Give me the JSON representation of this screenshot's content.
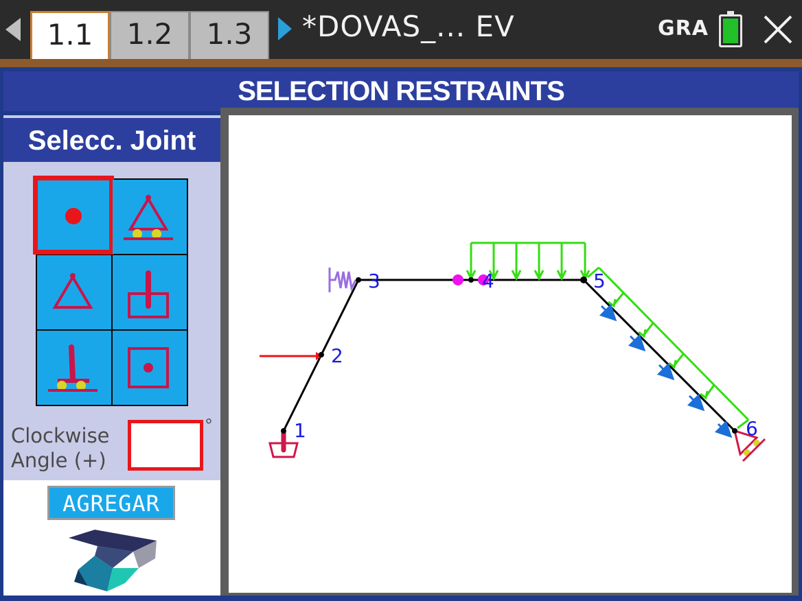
{
  "tabs": [
    {
      "label": "1.1",
      "active": true
    },
    {
      "label": "1.2",
      "active": false
    },
    {
      "label": "1.3",
      "active": false
    }
  ],
  "document": {
    "title": "*DOVAS_... EV"
  },
  "status": {
    "mode": "GRA",
    "battery_color": "#22c12a"
  },
  "header": {
    "title": "SELECTION RESTRAINTS"
  },
  "panel": {
    "title": "Selecc. Joint",
    "restraint_icons": [
      "free-joint-icon",
      "roller-pin-icon",
      "pin-support-icon",
      "fixed-support-icon",
      "roller-fixed-icon",
      "fixed-point-icon"
    ],
    "selected_index": 0,
    "angle_label_line1": "Clockwise",
    "angle_label_line2": "Angle (+)",
    "angle_value": "",
    "degree_symbol": "°",
    "add_button": "AGREGAR"
  },
  "structure": {
    "joint_labels": [
      "1",
      "2",
      "3",
      "4",
      "5",
      "6"
    ],
    "colors": {
      "member": "#000000",
      "restraint": "#d0164a",
      "distributed_load": "#33dd11",
      "axial_load": "#1a6fd8",
      "point_load": "#e8161b",
      "spring": "#9a6fe0",
      "hinge": "#ee11ee",
      "joint_label": "#1a1ae0"
    }
  }
}
